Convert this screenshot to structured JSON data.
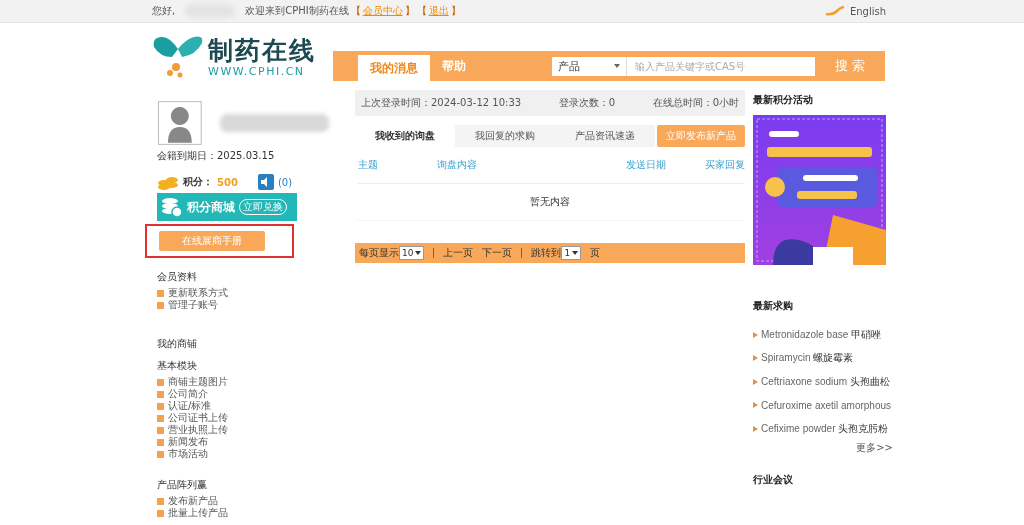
{
  "top_bar": {
    "greeting": "您好,",
    "welcome": "欢迎来到CPHI制药在线",
    "links": [
      {
        "open": "【",
        "label": "会员中心",
        "close": "】"
      },
      {
        "open": "【",
        "label": "退出",
        "close": "】"
      }
    ],
    "language": "English"
  },
  "logo": {
    "name": "制药在线",
    "url": "WWW.CPHI.CN"
  },
  "nav": {
    "tabs": [
      {
        "label": "我的消息",
        "selected": true
      },
      {
        "label": "帮助",
        "selected": false
      }
    ],
    "search": {
      "category": "产品",
      "placeholder": "输入产品关键字或CAS号",
      "button": "搜 索"
    }
  },
  "profile": {
    "expiry": "会籍到期日：2025.03.15",
    "points_label": "积分：",
    "points": "500",
    "messages": "(0)",
    "mall": {
      "title": "积分商城",
      "action": "立即兑换"
    },
    "handbook_button": {
      "label": "在线展商手册",
      "highlighted": true
    }
  },
  "sidebar": [
    {
      "kind": "group",
      "title": "会员资料",
      "items": [
        "更新联系方式",
        "管理子账号"
      ]
    },
    {
      "kind": "heading",
      "title": "我的商铺"
    },
    {
      "kind": "group",
      "title": "基本模块",
      "items": [
        "商铺主题图片",
        "公司简介",
        "认证/标准",
        "公司证书上传",
        "营业执照上传",
        "新闻发布",
        "市场活动"
      ]
    },
    {
      "kind": "group",
      "title": "产品阵列赢",
      "items": [
        "发布新产品",
        "批量上传产品"
      ]
    }
  ],
  "stats": [
    "上次登录时间：2024-03-12 10:33",
    "登录次数：0",
    "在线总时间：0小时"
  ],
  "inbox_tabs": [
    {
      "label": "我收到的询盘",
      "selected": true
    },
    {
      "label": "我回复的求购",
      "selected": false
    },
    {
      "label": "产品资讯速递",
      "selected": false
    }
  ],
  "publish_button": "立即发布新产品",
  "columns": [
    "主题",
    "询盘内容",
    "发送日期",
    "买家回复"
  ],
  "empty_text": "暂无内容",
  "pager": {
    "per_page_label": "每页显示",
    "per_page": "10",
    "prev": "上一页",
    "next": "下一页",
    "jump_label": "跳转到",
    "page": "1",
    "page_unit": "页"
  },
  "points_activity": {
    "title": "最新积分活动"
  },
  "latest_purchases": {
    "title": "最新求购",
    "items": [
      {
        "en": "Metronidazole base",
        "zh": "甲硝唑"
      },
      {
        "en": "Spiramycin",
        "zh": "螺旋霉素"
      },
      {
        "en": "Ceftriaxone sodium",
        "zh": "头孢曲松"
      },
      {
        "en": "Cefuroxime axetil amorphous"
      },
      {
        "en": "Cefixime powder",
        "zh": "头孢克肟粉"
      }
    ],
    "more": "更多>>"
  },
  "industry_meetings": {
    "title": "行业会议"
  }
}
